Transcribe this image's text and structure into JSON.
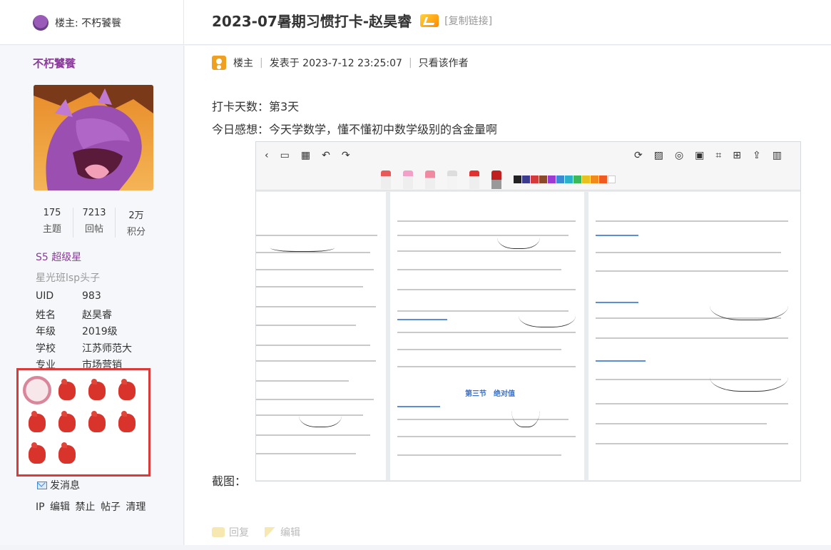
{
  "header": {
    "owner_label": "楼主: 不朽饕餮",
    "thread_title": "2023-07暑期习惯打卡-赵昊睿",
    "copy_link": "[复制链接]"
  },
  "profile": {
    "username": "不朽饕餮",
    "stats": [
      {
        "value": "175",
        "label": "主题"
      },
      {
        "value": "7213",
        "label": "回帖"
      },
      {
        "value": "2万",
        "label": "积分"
      }
    ],
    "rank": "S5 超级星",
    "title": "星光班lsp头子",
    "info": [
      {
        "key": "UID",
        "value": "983"
      },
      {
        "key": "姓名",
        "value": "赵昊睿"
      },
      {
        "key": "年级",
        "value": "2019级"
      },
      {
        "key": "学校",
        "value": "江苏师范大"
      },
      {
        "key": "专业",
        "value": "市场营销"
      }
    ],
    "send_message": "发消息",
    "admin_links": [
      "IP",
      "编辑",
      "禁止",
      "帖子",
      "清理"
    ]
  },
  "post": {
    "author_badge": "楼主",
    "posted_at": "发表于 2023-7-12 23:25:07",
    "only_author": "只看该作者",
    "days_line": "打卡天数：第3天",
    "feeling_line": "今日感想：今天学数学，懂不懂初中数学级别的含金量啊",
    "screenshot_label": "截图：",
    "actions": {
      "reply": "回复",
      "edit": "编辑"
    }
  },
  "screenshot": {
    "mid_heading": "第三节　绝对值",
    "colors": [
      "#222222",
      "#3b3b8f",
      "#d43a3a",
      "#8a4a2a",
      "#9b3bd4",
      "#3a8bd4",
      "#2ab0c8",
      "#3ab85a",
      "#e8c020",
      "#f08a1a",
      "#f05a20",
      "#ffffff"
    ]
  }
}
